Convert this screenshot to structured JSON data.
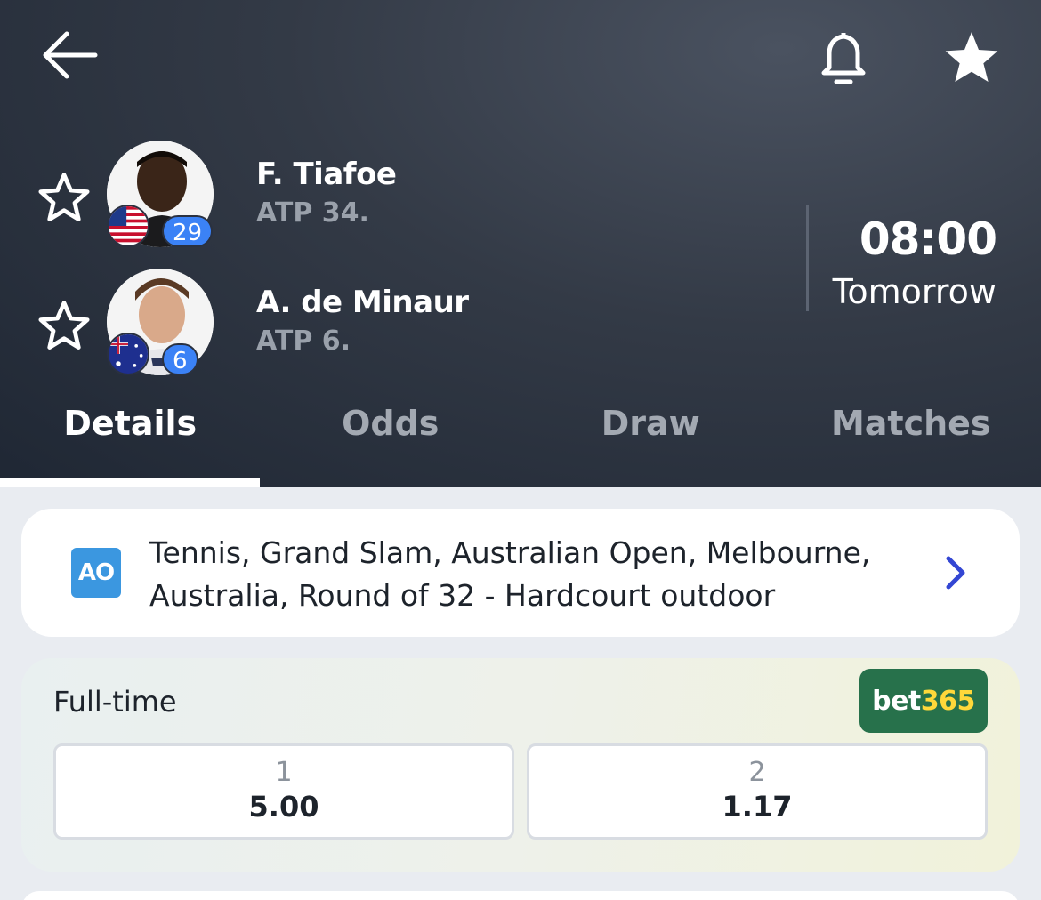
{
  "header": {
    "back_icon": "arrow-left-icon",
    "bell_icon": "bell-icon",
    "favorite_icon": "star-filled-icon"
  },
  "match": {
    "players": [
      {
        "name": "F. Tiafoe",
        "rank": "ATP 34.",
        "seed": "29",
        "flag": "united-states-flag"
      },
      {
        "name": "A. de Minaur",
        "rank": "ATP 6.",
        "seed": "6",
        "flag": "australia-flag"
      }
    ],
    "time": "08:00",
    "date": "Tomorrow"
  },
  "tabs": [
    {
      "label": "Details",
      "active": true
    },
    {
      "label": "Odds",
      "active": false
    },
    {
      "label": "Draw",
      "active": false
    },
    {
      "label": "Matches",
      "active": false
    }
  ],
  "tournament": {
    "logo": "AO",
    "text": "Tennis, Grand Slam, Australian Open, Melbourne, Australia, Round of 32 - Hardcourt outdoor"
  },
  "odds": {
    "title": "Full-time",
    "bookmaker_part1": "bet",
    "bookmaker_part2": "365",
    "options": [
      {
        "label": "1",
        "value": "5.00"
      },
      {
        "label": "2",
        "value": "1.17"
      }
    ]
  },
  "colors": {
    "header_bg": "#2a3140",
    "accent_blue": "#3b82f6",
    "chevron": "#3346d3",
    "bet365_green": "#27714b",
    "bet365_yellow": "#ffd83a"
  }
}
